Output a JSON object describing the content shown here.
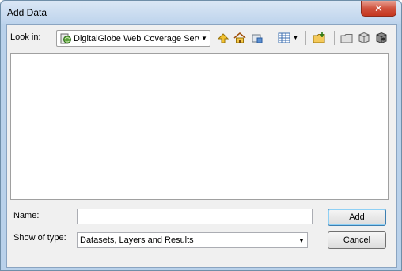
{
  "window": {
    "title": "Add Data",
    "close_label": "✕"
  },
  "lookin": {
    "label": "Look in:",
    "value": "DigitalGlobe Web Coverage Serv"
  },
  "toolbar": {
    "icons": [
      "up-one-level-icon",
      "home-icon",
      "connect-folder-icon",
      "views-icon",
      "new-folder-icon",
      "folder-icon",
      "database-icon",
      "server-icon"
    ]
  },
  "form": {
    "name_label": "Name:",
    "name_value": "",
    "type_label": "Show of type:",
    "type_value": "Datasets, Layers and Results"
  },
  "buttons": {
    "add": "Add",
    "cancel": "Cancel"
  },
  "colors": {
    "frame": "#b9d1ea",
    "client": "#f0f0f0",
    "close": "#c5371f",
    "default_button_border": "#3c7fb1"
  }
}
